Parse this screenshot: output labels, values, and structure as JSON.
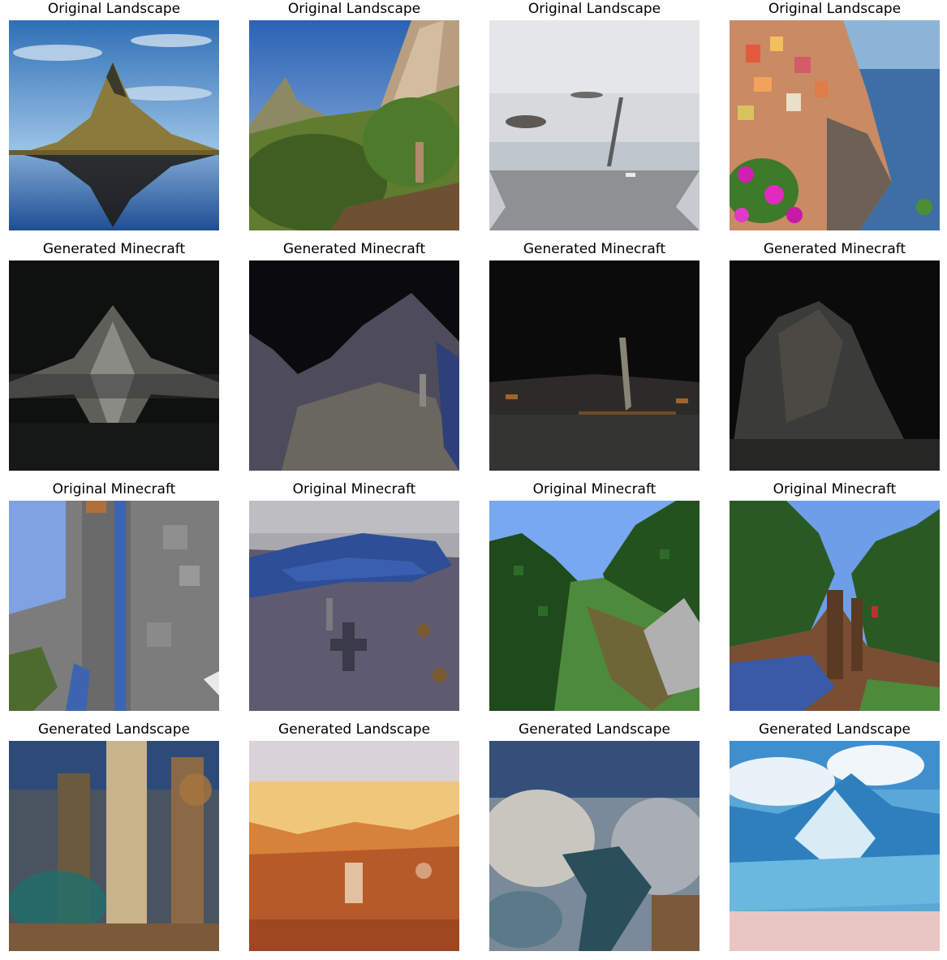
{
  "grid": {
    "rows": [
      {
        "label": "Original Landscape",
        "cells": [
          {
            "title": "Original Landscape",
            "scene": "lake-mountain-reflection"
          },
          {
            "title": "Original Landscape",
            "scene": "mountain-hiker-valley"
          },
          {
            "title": "Original Landscape",
            "scene": "glacier-lake"
          },
          {
            "title": "Original Landscape",
            "scene": "coastal-village-flowers"
          }
        ]
      },
      {
        "label": "Generated Minecraft",
        "cells": [
          {
            "title": "Generated Minecraft",
            "scene": "dark-peak-reflection"
          },
          {
            "title": "Generated Minecraft",
            "scene": "dark-valley"
          },
          {
            "title": "Generated Minecraft",
            "scene": "dark-glacier"
          },
          {
            "title": "Generated Minecraft",
            "scene": "dark-cliff"
          }
        ]
      },
      {
        "label": "Original Minecraft",
        "cells": [
          {
            "title": "Original Minecraft",
            "scene": "blocky-cliff-waterfall"
          },
          {
            "title": "Original Minecraft",
            "scene": "blocky-pond-plain"
          },
          {
            "title": "Original Minecraft",
            "scene": "blocky-forest-valley"
          },
          {
            "title": "Original Minecraft",
            "scene": "blocky-forest-river"
          }
        ]
      },
      {
        "label": "Generated Landscape",
        "cells": [
          {
            "title": "Generated Landscape",
            "scene": "painted-waterfall-cliff"
          },
          {
            "title": "Generated Landscape",
            "scene": "painted-red-desert"
          },
          {
            "title": "Generated Landscape",
            "scene": "painted-river-valley"
          },
          {
            "title": "Generated Landscape",
            "scene": "painted-ocean-waves"
          }
        ]
      }
    ]
  }
}
